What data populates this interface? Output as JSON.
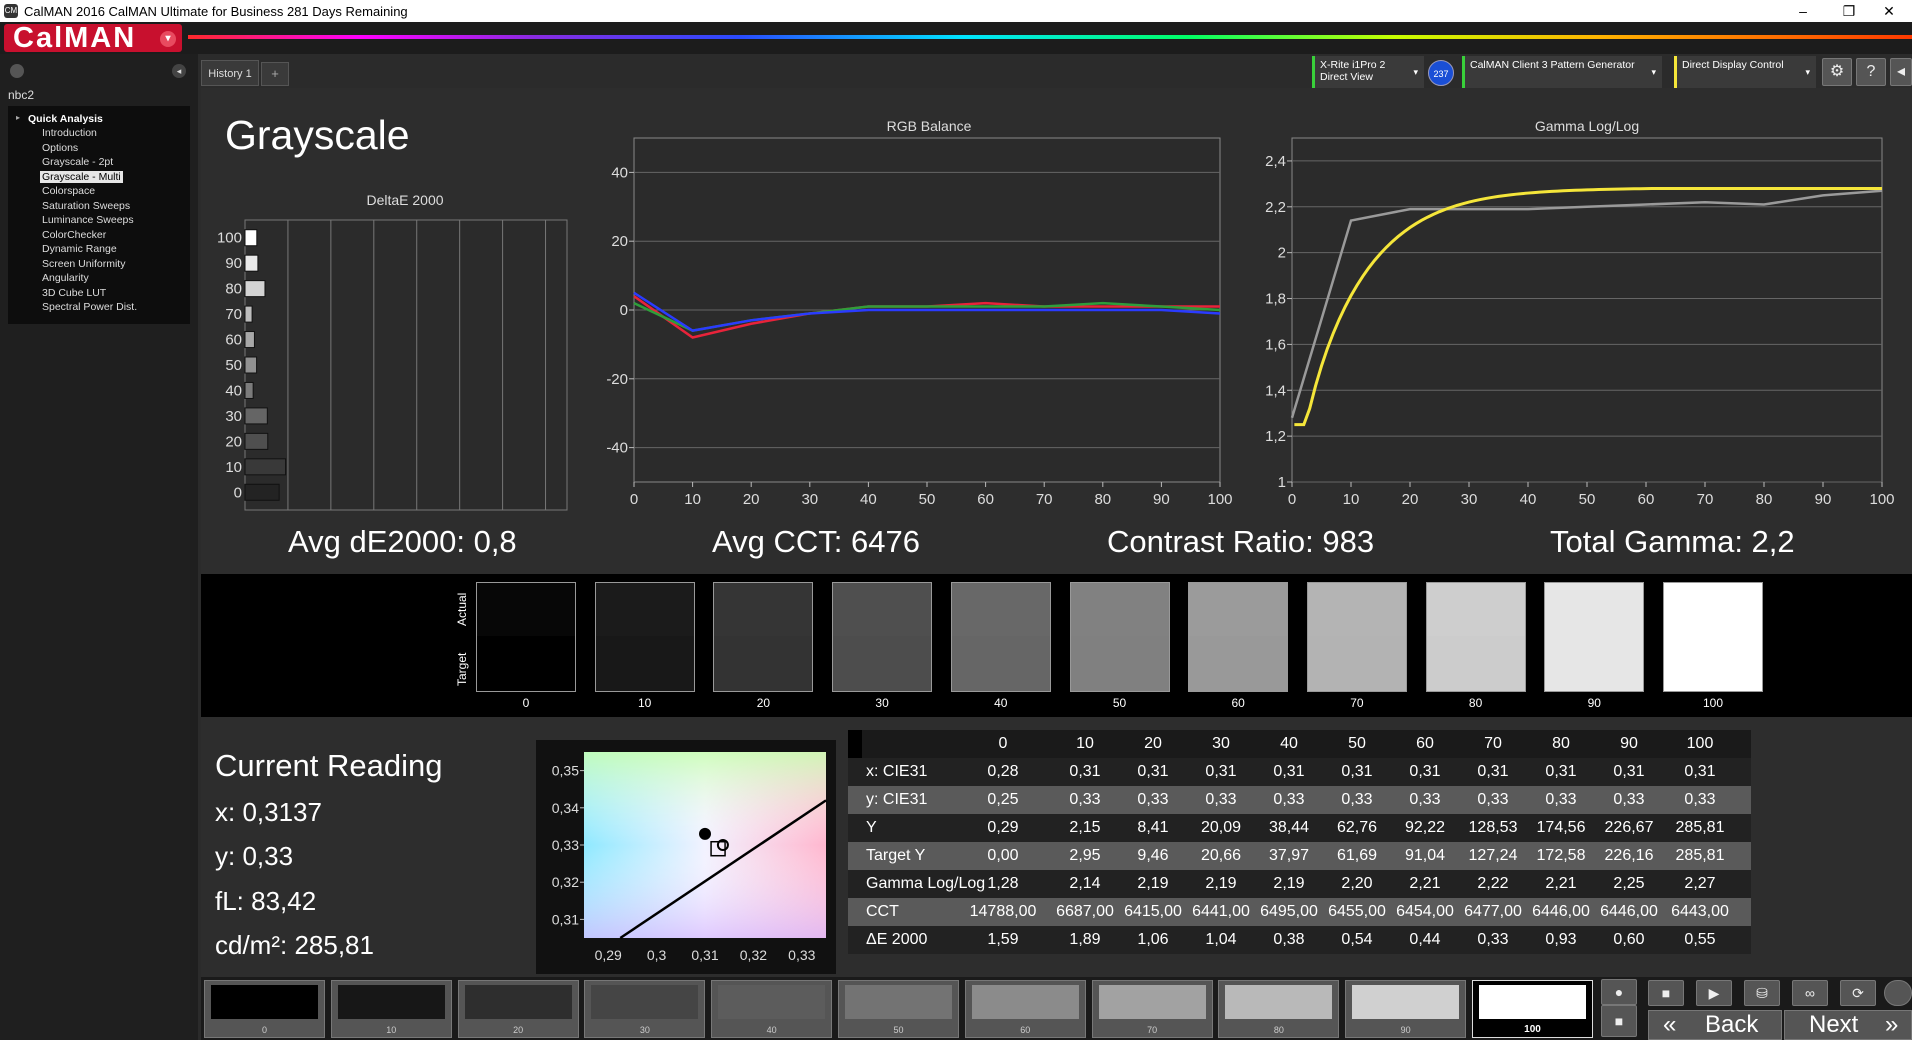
{
  "window": {
    "title": "CalMAN 2016 CalMAN Ultimate for Business 281 Days Remaining",
    "app_icon": "calman-app-icon",
    "min": "–",
    "restore": "❐",
    "close": "✕"
  },
  "logo": {
    "text": "CalMAN",
    "drop": "▾"
  },
  "sidebar": {
    "project": "nbc2",
    "collapse": "◂",
    "root": "Quick Analysis",
    "items": [
      "Introduction",
      "Options",
      "Grayscale - 2pt",
      "Grayscale - Multi",
      "Colorspace",
      "Saturation Sweeps",
      "Luminance Sweeps",
      "ColorChecker",
      "Dynamic Range",
      "Screen Uniformity",
      "Angularity",
      "3D Cube LUT",
      "Spectral Power Dist."
    ],
    "selected_index": 3
  },
  "tabs": {
    "history": "History 1",
    "add": "+"
  },
  "devices": {
    "meter_line1": "X-Rite i1Pro 2",
    "meter_line2": "Direct View",
    "meter_badge": "237",
    "pattern": "CalMAN Client 3 Pattern Generator",
    "display": "Direct Display Control",
    "chevron": "▾",
    "settings_icon": "⚙",
    "help_icon": "?",
    "expand_icon": "◂"
  },
  "page": {
    "title": "Grayscale"
  },
  "stats": {
    "avg_de": "Avg dE2000: 0,8",
    "avg_cct": "Avg CCT: 6476",
    "contrast": "Contrast Ratio: 983",
    "gamma": "Total Gamma: 2,2"
  },
  "chart_data": [
    {
      "type": "bar",
      "title": "DeltaE 2000",
      "orientation": "horizontal",
      "categories": [
        "100",
        "90",
        "80",
        "70",
        "60",
        "50",
        "40",
        "30",
        "20",
        "10",
        "0"
      ],
      "values": [
        0.55,
        0.6,
        0.93,
        0.33,
        0.44,
        0.54,
        0.38,
        1.04,
        1.06,
        1.89,
        1.59
      ],
      "xticks": [
        "0",
        "2",
        "4",
        "6",
        "8",
        "10",
        "12",
        "14"
      ],
      "xlim": [
        0,
        15
      ]
    },
    {
      "type": "line",
      "title": "RGB Balance",
      "x": [
        0,
        10,
        20,
        30,
        40,
        50,
        60,
        70,
        80,
        90,
        100
      ],
      "xticks": [
        "0",
        "10",
        "20",
        "30",
        "40",
        "50",
        "60",
        "70",
        "80",
        "90",
        "100"
      ],
      "yticks": [
        "40",
        "20",
        "0",
        "-20",
        "-40"
      ],
      "ylim": [
        -50,
        50
      ],
      "series": [
        {
          "color": "#e8233a",
          "values": [
            4,
            -8,
            -4,
            -1,
            1,
            1,
            2,
            1,
            1,
            1,
            1
          ]
        },
        {
          "color": "#2e9e3a",
          "values": [
            2,
            -6,
            -3,
            -1,
            1,
            1,
            1,
            1,
            2,
            1,
            0
          ]
        },
        {
          "color": "#2a3bff",
          "values": [
            5,
            -6,
            -3,
            -1,
            0,
            0,
            0,
            0,
            0,
            0,
            -1
          ]
        }
      ]
    },
    {
      "type": "line",
      "title": "Gamma Log/Log",
      "x": [
        0,
        10,
        20,
        30,
        40,
        50,
        60,
        70,
        80,
        90,
        100
      ],
      "xticks": [
        "0",
        "10",
        "20",
        "30",
        "40",
        "50",
        "60",
        "70",
        "80",
        "90",
        "100"
      ],
      "yticks": [
        "2,4",
        "2,2",
        "2",
        "1,8",
        "1,6",
        "1,4",
        "1,2",
        "1"
      ],
      "ylim": [
        1,
        2.5
      ],
      "series": [
        {
          "color": "#9a9a9a",
          "values": [
            1.28,
            2.14,
            2.19,
            2.19,
            2.19,
            2.2,
            2.21,
            2.22,
            2.21,
            2.25,
            2.27
          ]
        },
        {
          "color": "#f5e63a",
          "curve": "target",
          "target_gamma": 2.2
        }
      ]
    },
    {
      "type": "scatter",
      "title": "",
      "xticks": [
        "0,29",
        "0,3",
        "0,31",
        "0,32",
        "0,33"
      ],
      "yticks": [
        "0,35",
        "0,34",
        "0,33",
        "0,32",
        "0,31"
      ],
      "xlim": [
        0.285,
        0.335
      ],
      "ylim": [
        0.305,
        0.355
      ],
      "points": [
        {
          "x": 0.31,
          "y": 0.333,
          "label": "measured"
        },
        {
          "x": 0.3137,
          "y": 0.33,
          "label": "current"
        }
      ],
      "target": {
        "x": 0.3127,
        "y": 0.329
      }
    }
  ],
  "swatches": {
    "actual_label": "Actual",
    "target_label": "Target",
    "items": [
      {
        "label": "0",
        "actual": "#070707",
        "target": "#000000"
      },
      {
        "label": "10",
        "actual": "#1b1b1b",
        "target": "#181818"
      },
      {
        "label": "20",
        "actual": "#353535",
        "target": "#333333"
      },
      {
        "label": "30",
        "actual": "#4f4f4f",
        "target": "#4d4d4d"
      },
      {
        "label": "40",
        "actual": "#686868",
        "target": "#666666"
      },
      {
        "label": "50",
        "actual": "#818181",
        "target": "#808080"
      },
      {
        "label": "60",
        "actual": "#9b9b9b",
        "target": "#999999"
      },
      {
        "label": "70",
        "actual": "#b4b4b4",
        "target": "#b3b3b3"
      },
      {
        "label": "80",
        "actual": "#cecece",
        "target": "#cccccc"
      },
      {
        "label": "90",
        "actual": "#e6e6e6",
        "target": "#e6e6e6"
      },
      {
        "label": "100",
        "actual": "#ffffff",
        "target": "#ffffff"
      }
    ]
  },
  "current_reading": {
    "title": "Current Reading",
    "x": "x: 0,3137",
    "y": "y: 0,33",
    "fl": "fL: 83,42",
    "cdm": "cd/m²: 285,81"
  },
  "table": {
    "headers": [
      "0",
      "10",
      "20",
      "30",
      "40",
      "50",
      "60",
      "70",
      "80",
      "90",
      "100"
    ],
    "rows": [
      {
        "label": "x: CIE31",
        "values": [
          "0,28",
          "0,31",
          "0,31",
          "0,31",
          "0,31",
          "0,31",
          "0,31",
          "0,31",
          "0,31",
          "0,31",
          "0,31"
        ]
      },
      {
        "label": "y: CIE31",
        "values": [
          "0,25",
          "0,33",
          "0,33",
          "0,33",
          "0,33",
          "0,33",
          "0,33",
          "0,33",
          "0,33",
          "0,33",
          "0,33"
        ]
      },
      {
        "label": "Y",
        "values": [
          "0,29",
          "2,15",
          "8,41",
          "20,09",
          "38,44",
          "62,76",
          "92,22",
          "128,53",
          "174,56",
          "226,67",
          "285,81"
        ]
      },
      {
        "label": "Target Y",
        "values": [
          "0,00",
          "2,95",
          "9,46",
          "20,66",
          "37,97",
          "61,69",
          "91,04",
          "127,24",
          "172,58",
          "226,16",
          "285,81"
        ]
      },
      {
        "label": "Gamma Log/Log",
        "values": [
          "1,28",
          "2,14",
          "2,19",
          "2,19",
          "2,19",
          "2,20",
          "2,21",
          "2,22",
          "2,21",
          "2,25",
          "2,27"
        ]
      },
      {
        "label": "CCT",
        "values": [
          "14788,00",
          "6687,00",
          "6415,00",
          "6441,00",
          "6495,00",
          "6455,00",
          "6454,00",
          "6477,00",
          "6446,00",
          "6446,00",
          "6443,00"
        ]
      },
      {
        "label": "ΔE 2000",
        "values": [
          "1,59",
          "1,89",
          "1,06",
          "1,04",
          "0,38",
          "0,54",
          "0,44",
          "0,33",
          "0,93",
          "0,60",
          "0,55"
        ]
      }
    ]
  },
  "patches": {
    "items": [
      {
        "label": "0",
        "color": "#000000"
      },
      {
        "label": "10",
        "color": "#171717"
      },
      {
        "label": "20",
        "color": "#2e2e2e"
      },
      {
        "label": "30",
        "color": "#454545"
      },
      {
        "label": "40",
        "color": "#5c5c5c"
      },
      {
        "label": "50",
        "color": "#737373"
      },
      {
        "label": "60",
        "color": "#8b8b8b"
      },
      {
        "label": "70",
        "color": "#a2a2a2"
      },
      {
        "label": "80",
        "color": "#b9b9b9"
      },
      {
        "label": "90",
        "color": "#d0d0d0"
      },
      {
        "label": "100",
        "color": "#ffffff"
      }
    ],
    "active_index": 10
  },
  "controls": {
    "stop": "■",
    "play": "▶",
    "save": "⛁",
    "loop": "∞",
    "refresh": "⟳",
    "record": "●",
    "single": "■",
    "back": "Back",
    "next": "Next",
    "back_icon": "«",
    "next_icon": "»"
  }
}
